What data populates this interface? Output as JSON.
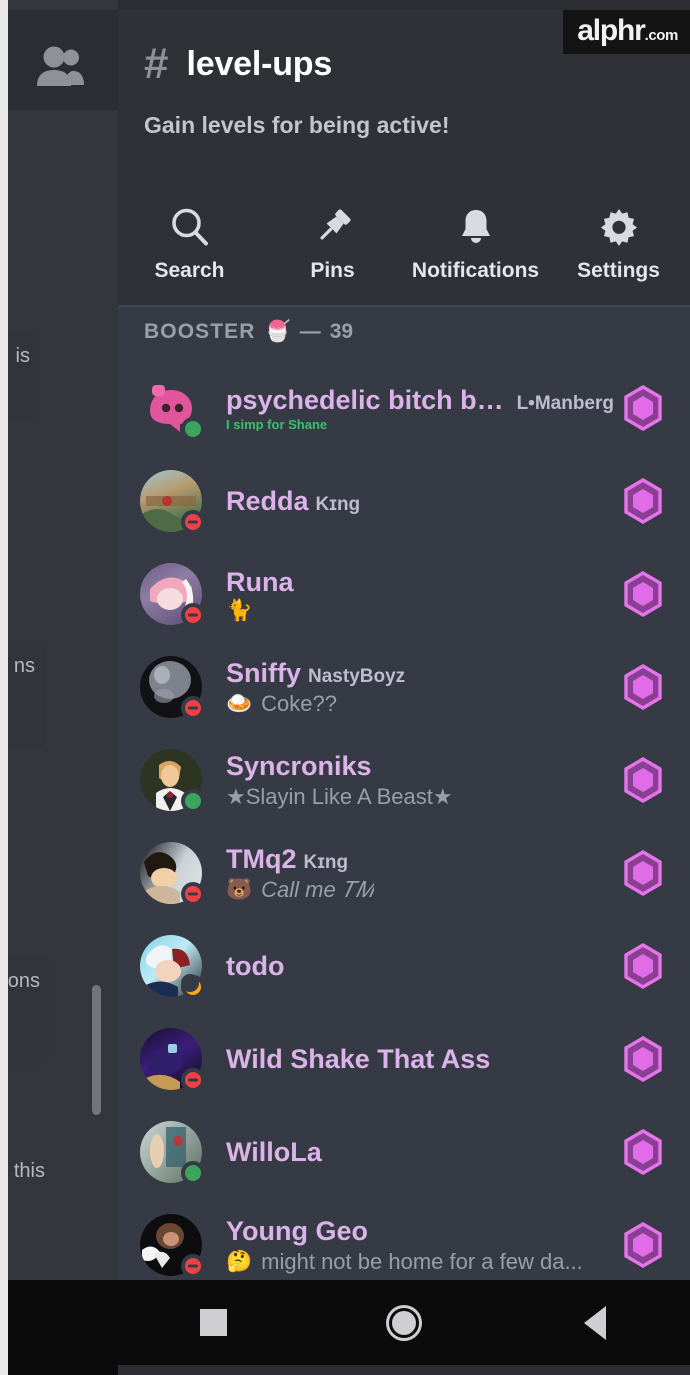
{
  "watermark": {
    "main": "alphr",
    "tld": ".com"
  },
  "channel": {
    "hash": "#",
    "name": "level-ups",
    "topic": "Gain levels for being active!"
  },
  "actions": [
    {
      "label": "Search",
      "icon": "search-icon"
    },
    {
      "label": "Pins",
      "icon": "pin-icon"
    },
    {
      "label": "Notifications",
      "icon": "bell-icon"
    },
    {
      "label": "Settings",
      "icon": "gear-icon"
    }
  ],
  "group": {
    "label": "BOOSTER",
    "emoji": "🍧",
    "separator": "—",
    "count": "39"
  },
  "members": [
    {
      "name": "psychedelic bitch baby",
      "tag": "L•Manberg",
      "status": "I simp for Shane",
      "status_emoji": "",
      "status_kind": "custom-image",
      "presence": "online",
      "badge": "boost-badge"
    },
    {
      "name": "Redda",
      "tag": "Kɪng",
      "status": "",
      "status_emoji": "",
      "status_kind": "",
      "presence": "dnd",
      "badge": "boost-badge"
    },
    {
      "name": "Runa",
      "tag": "",
      "status": "",
      "status_emoji": "🐈",
      "status_kind": "emoji-only",
      "presence": "dnd",
      "badge": "boost-badge"
    },
    {
      "name": "Sniffy",
      "tag": "NastyBoyz",
      "status": "Coke??",
      "status_emoji": "🍛",
      "status_kind": "text",
      "presence": "dnd",
      "badge": "boost-badge"
    },
    {
      "name": "Syncroniks",
      "tag": "",
      "status": "★Slayin Like A Beast★",
      "status_emoji": "",
      "status_kind": "text",
      "presence": "online",
      "badge": "boost-badge"
    },
    {
      "name": "TMq2",
      "tag": "Kɪng",
      "status": "Call me 𝑇𝑀",
      "status_emoji": "🐻",
      "status_kind": "italic",
      "presence": "dnd",
      "badge": "boost-badge"
    },
    {
      "name": "todo",
      "tag": "",
      "status": "",
      "status_emoji": "",
      "status_kind": "",
      "presence": "idle",
      "badge": "boost-badge"
    },
    {
      "name": "Wild Shake That Ass",
      "tag": "",
      "status": "",
      "status_emoji": "",
      "status_kind": "",
      "presence": "dnd",
      "badge": "boost-badge"
    },
    {
      "name": "WilloLa",
      "tag": "",
      "status": "",
      "status_emoji": "",
      "status_kind": "",
      "presence": "online",
      "badge": "boost-badge"
    },
    {
      "name": "Young Geo",
      "tag": "",
      "status": "might not be home for a few da...",
      "status_emoji": "🤔",
      "status_kind": "text",
      "presence": "dnd",
      "badge": "boost-badge"
    }
  ],
  "background_fragments": [
    {
      "text": "is"
    },
    {
      "text": "ns"
    },
    {
      "text": "ons"
    },
    {
      "text": "this"
    }
  ],
  "navbar": [
    {
      "icon": "recents-square-icon"
    },
    {
      "icon": "home-circle-icon"
    },
    {
      "icon": "back-triangle-icon"
    }
  ],
  "colors": {
    "drawer_bg": "#363a45",
    "header_bg": "#2f3136",
    "username": "#dcb3e8",
    "boost_badge": "#e06ce8",
    "online": "#3ba55d",
    "dnd": "#ed4245",
    "idle": "#faa81a"
  }
}
